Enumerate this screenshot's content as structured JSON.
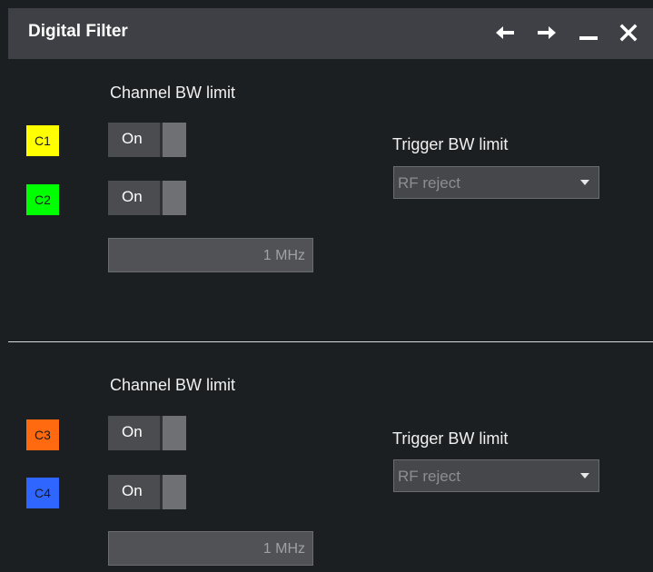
{
  "window": {
    "title": "Digital Filter",
    "controls": [
      "arrow-left-icon",
      "arrow-right-icon",
      "minimize-icon",
      "close-icon"
    ]
  },
  "group1": {
    "channel_bw_label": "Channel BW limit",
    "channels": [
      {
        "label": "C1",
        "color": "#ffff00",
        "toggle": "On"
      },
      {
        "label": "C2",
        "color": "#00ff00",
        "toggle": "On"
      }
    ],
    "bandwidth_value": "1 MHz",
    "trigger_bw_label": "Trigger BW limit",
    "trigger_value": "RF reject"
  },
  "group2": {
    "channel_bw_label": "Channel BW limit",
    "channels": [
      {
        "label": "C3",
        "color": "#ff6a10",
        "toggle": "On"
      },
      {
        "label": "C4",
        "color": "#2f66ff",
        "toggle": "On"
      }
    ],
    "bandwidth_value": "1 MHz",
    "trigger_bw_label": "Trigger BW limit",
    "trigger_value": "RF reject"
  }
}
